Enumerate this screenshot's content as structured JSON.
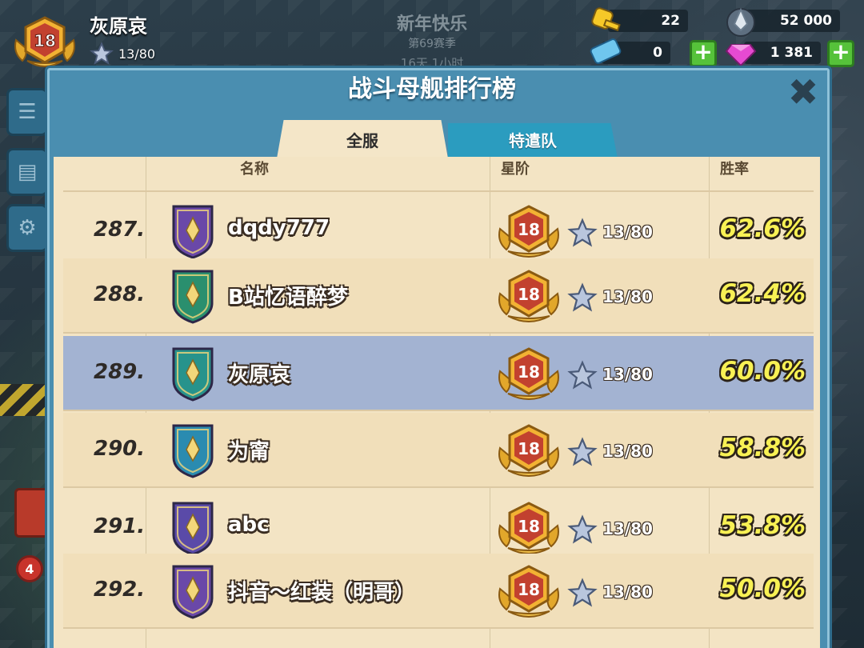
{
  "event": {
    "title": "新年快乐",
    "season": "第69赛季",
    "timer": "16天 1小时"
  },
  "player": {
    "level": "18",
    "name": "灰原哀",
    "stars": "13/80"
  },
  "resources": {
    "keys": "22",
    "stone": "52 000",
    "tickets": "0",
    "gems": "1 381"
  },
  "panel": {
    "title": "战斗母舰排行榜",
    "tabs": [
      {
        "label": "全服"
      },
      {
        "label": "特遣队"
      }
    ],
    "columns": {
      "name": "名称",
      "tier": "星阶",
      "winrate": "胜率"
    }
  },
  "side": {
    "badge_count": "4"
  },
  "colors": {
    "panel": "#4a8eb0",
    "sheet": "#f3e4c4",
    "highlight": "#a3b3d2",
    "winrate": "#f8f154"
  },
  "rows": [
    {
      "rank": "287.",
      "name": "dqdy777",
      "tier": "18",
      "stars": "13/80",
      "winrate": "62.6%",
      "emblem": "wolf-emblem-icon",
      "emblem_color": "#6a48a8"
    },
    {
      "rank": "288.",
      "name": "B站忆语醉梦",
      "tier": "18",
      "stars": "13/80",
      "winrate": "62.4%",
      "emblem": "chevron-rank-emblem-icon",
      "emblem_color": "#2a8f6e"
    },
    {
      "rank": "289.",
      "name": "灰原哀",
      "tier": "18",
      "stars": "13/80",
      "winrate": "60.0%",
      "emblem": "crossed-rifles-emblem-icon",
      "emblem_color": "#27938c"
    },
    {
      "rank": "290.",
      "name": "为甯",
      "tier": "18",
      "stars": "13/80",
      "winrate": "58.8%",
      "emblem": "dagger-emblem-icon",
      "emblem_color": "#2a8bb0"
    },
    {
      "rank": "291.",
      "name": "abc",
      "tier": "18",
      "stars": "13/80",
      "winrate": "53.8%",
      "emblem": "fist-emblem-icon",
      "emblem_color": "#5a4aa8"
    },
    {
      "rank": "292.",
      "name": "抖音～红装（明哥）",
      "tier": "18",
      "stars": "13/80",
      "winrate": "50.0%",
      "emblem": "winged-skull-emblem-icon",
      "emblem_color": "#6a48a8"
    }
  ]
}
